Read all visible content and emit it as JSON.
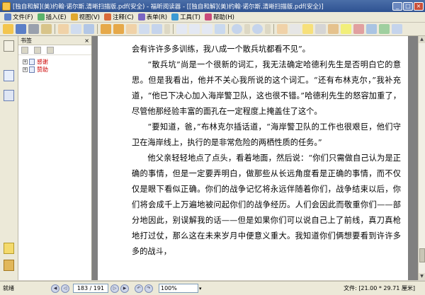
{
  "window": {
    "title": "[独自和解](美)约翰·诺尔斯.清晰扫描版.pdf(安全) - 福昕阅读器 - [[独自和解](美)约翰·诺尔斯.清晰扫描版.pdf(安全)]",
    "buttons": [
      "_",
      "□",
      "×"
    ]
  },
  "menu": [
    {
      "label": "文件(F)",
      "icon_color": "#5b7fc7"
    },
    {
      "label": "插入(E)",
      "icon_color": "#5bb36b"
    },
    {
      "label": "视图(V)",
      "icon_color": "#e0a82e"
    },
    {
      "label": "注释(C)",
      "icon_color": "#d96a3a"
    },
    {
      "label": "表单(R)",
      "icon_color": "#7a66c3"
    },
    {
      "label": "工具(T)",
      "icon_color": "#3c9ad4"
    },
    {
      "label": "帮助(H)",
      "icon_color": "#c94a7a"
    }
  ],
  "bookmarks": {
    "header": "书签",
    "items": [
      {
        "label": "感谢"
      },
      {
        "label": "赞助"
      }
    ]
  },
  "document": {
    "paragraphs": [
      {
        "cont": true,
        "text": "会有许许多多训练，我八成一个散兵坑都看不见”。"
      },
      {
        "cont": false,
        "text": "“散兵坑”尚是一个很新的词汇，我无法确定哈德利先生是否明白它的意思。但是我看出，他并不关心我所说的这个词汇。“还有布林克尔，”我补充道，“他已下决心加入海岸警卫队，这也很不错。”哈德利先生的怒容加重了，尽管他那经验丰富的面孔在一定程度上掩盖住了这个。"
      },
      {
        "cont": false,
        "text": "“要知道，爸，”布林克尔插话道，“海岸警卫队的工作也很艰巨，他们守卫在海岸线上，执行的是非常危险的两栖性质的任务。”"
      },
      {
        "cont": false,
        "text": "他父亲轻轻地点了点头，看着地面，然后说：“你们只需做自己认为是正确的事情，但是一定要弄明白，做那些从长远角度看是正确的事情，而不仅仅是眼下看似正确。你们的战争记忆将永远伴随着你们，战争结束以后，你们将会成千上万遍地被问起你们的战争经历。人们会因此而敬重你们——部分地因此，别误解我的话——但是如果你们可以说自己上了前线，真刀真枪地打过仗，那么这在未来岁月中便意义重大。我知道你们俩想要看到许许多多的战斗，"
      }
    ]
  },
  "status": {
    "left_label": "就绪",
    "page_value": "183 / 191",
    "zoom_value": "100%",
    "page_size": "文件: [21.00 * 29.71 厘米]"
  }
}
